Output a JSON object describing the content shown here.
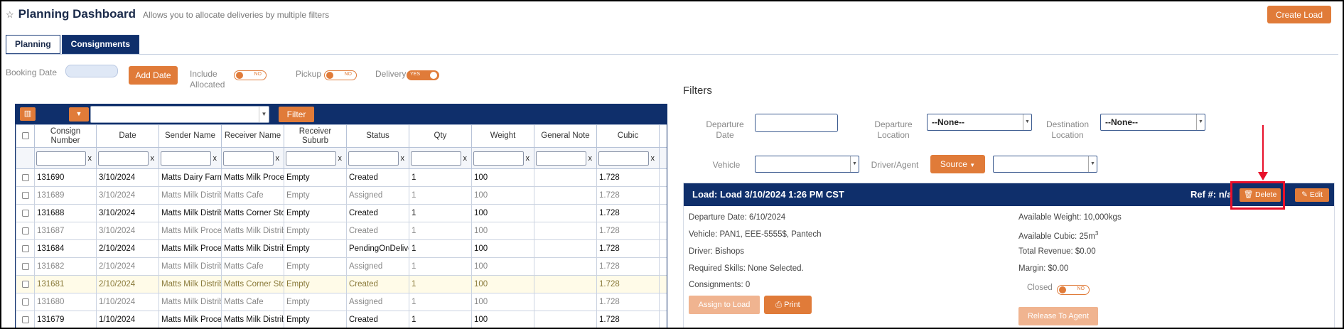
{
  "header": {
    "title": "Planning Dashboard",
    "subtitle": "Allows you to allocate deliveries by multiple filters",
    "create_load_label": "Create Load"
  },
  "tabs": [
    {
      "label": "Planning",
      "active": false
    },
    {
      "label": "Consignments",
      "active": true
    }
  ],
  "toolbar": {
    "booking_date_label": "Booking Date",
    "add_date_label": "Add Date",
    "include_allocated_label": "Include\nAllocated",
    "include_allocated_state": "NO",
    "pickup_label": "Pickup",
    "pickup_state": "NO",
    "delivery_label": "Delivery",
    "delivery_state": "YES"
  },
  "grid": {
    "filter_button_label": "Filter",
    "columns": [
      "Consign Number",
      "Date",
      "Sender Name",
      "Receiver Name",
      "Receiver Suburb",
      "Status",
      "Qty",
      "Weight",
      "General Note",
      "Cubic"
    ],
    "clear_label": "x",
    "rows": [
      {
        "style": "bold",
        "cells": [
          "131690",
          "3/10/2024",
          "Matts Dairy Farm",
          "Matts Milk Processing",
          "Empty",
          "Created",
          "1",
          "100",
          "",
          "1.728"
        ]
      },
      {
        "style": "dim",
        "cells": [
          "131689",
          "3/10/2024",
          "Matts Milk Distributor",
          "Matts Cafe",
          "Empty",
          "Assigned",
          "1",
          "100",
          "",
          "1.728"
        ]
      },
      {
        "style": "bold",
        "cells": [
          "131688",
          "3/10/2024",
          "Matts Milk Distributor",
          "Matts Corner Store",
          "Empty",
          "Created",
          "1",
          "100",
          "",
          "1.728"
        ]
      },
      {
        "style": "dim",
        "cells": [
          "131687",
          "3/10/2024",
          "Matts Milk Processing",
          "Matts Milk Distributor",
          "Empty",
          "Created",
          "1",
          "100",
          "",
          "1.728"
        ]
      },
      {
        "style": "bold",
        "cells": [
          "131684",
          "2/10/2024",
          "Matts Milk Processing",
          "Matts Milk Distributor",
          "Empty",
          "PendingOnDelivery",
          "1",
          "100",
          "",
          "1.728"
        ]
      },
      {
        "style": "dim",
        "cells": [
          "131682",
          "2/10/2024",
          "Matts Milk Distributor",
          "Matts Cafe",
          "Empty",
          "Assigned",
          "1",
          "100",
          "",
          "1.728"
        ]
      },
      {
        "style": "hl",
        "cells": [
          "131681",
          "2/10/2024",
          "Matts Milk Distributor",
          "Matts Corner Store",
          "Empty",
          "Created",
          "1",
          "100",
          "",
          "1.728"
        ]
      },
      {
        "style": "dim",
        "cells": [
          "131680",
          "1/10/2024",
          "Matts Milk Distributor",
          "Matts Cafe",
          "Empty",
          "Assigned",
          "1",
          "100",
          "",
          "1.728"
        ]
      },
      {
        "style": "bold",
        "cells": [
          "131679",
          "1/10/2024",
          "Matts Milk Processing",
          "Matts Milk Distributor",
          "Empty",
          "Created",
          "1",
          "100",
          "",
          "1.728"
        ]
      }
    ]
  },
  "filters": {
    "title": "Filters",
    "departure_date_label": "Departure\nDate",
    "departure_location_label": "Departure\nLocation",
    "departure_location_value": "--None--",
    "destination_location_label": "Destination\nLocation",
    "destination_location_value": "--None--",
    "vehicle_label": "Vehicle",
    "driver_agent_label": "Driver/Agent",
    "source_label": "Source"
  },
  "load": {
    "title": "Load: Load 3/10/2024 1:26 PM CST",
    "ref": "Ref #: n/a",
    "delete_label": "Delete",
    "edit_label": "Edit",
    "departure_date": "Departure Date: 6/10/2024",
    "vehicle": "Vehicle: PAN1, EEE-5555$, Pantech",
    "driver": "Driver: Bishops",
    "required_skills": "Required Skills: None Selected.",
    "consignments": "Consignments: 0",
    "available_weight": "Available Weight: 10,000kgs",
    "available_cubic": "Available Cubic: 25m",
    "available_cubic_sup": "3",
    "total_revenue": "Total Revenue: $0.00",
    "margin": "Margin: $0.00",
    "closed_label": "Closed",
    "closed_state": "NO",
    "assign_label": "Assign to Load",
    "print_label": "Print",
    "release_label": "Release To Agent"
  },
  "colors": {
    "accent": "#e07b39",
    "navy": "#0f2f6b",
    "annotation_red": "#e8102a"
  }
}
